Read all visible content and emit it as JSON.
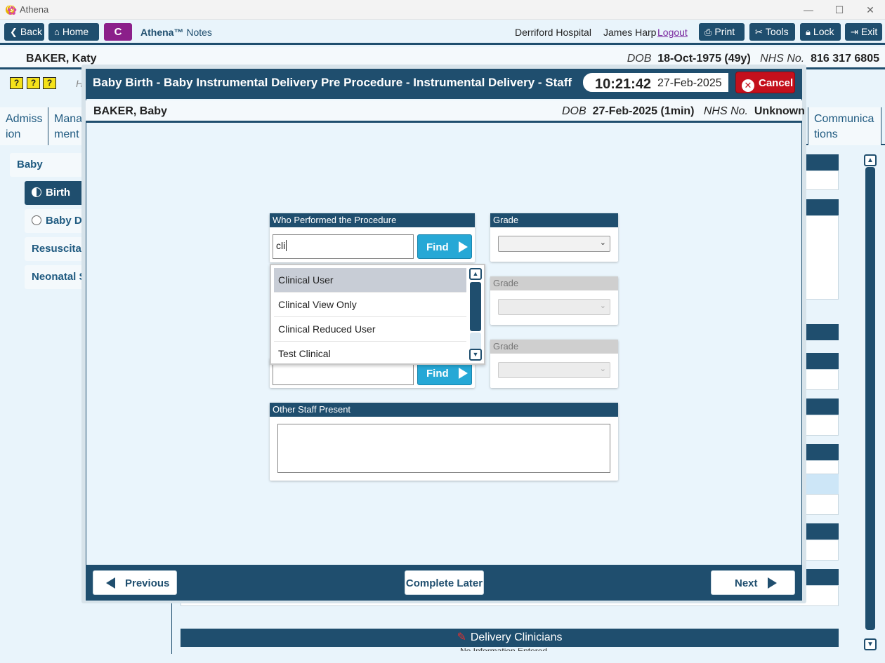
{
  "window": {
    "title": "Athena",
    "logo_glyph": "Ⓐ",
    "minimize": "—",
    "maximize": "☐",
    "close": "✕"
  },
  "toolbar": {
    "back": "Back",
    "home": "Home",
    "badge": "C",
    "brand": "Athena™",
    "brand_suffix": "Notes",
    "hospital": "Derriford Hospital",
    "user": "James Harp",
    "logout": "Logout",
    "print": "Print",
    "tools": "Tools",
    "lock": "Lock",
    "exit": "Exit"
  },
  "patient": {
    "name": "BAKER, Katy",
    "dob_label": "DOB",
    "dob": "18-Oct-1975 (49y)",
    "nhs_label": "NHS No.",
    "nhs": "816 317 6805"
  },
  "background": {
    "help_icons": [
      "?",
      "?",
      "?"
    ],
    "help_text": "H",
    "tabs": [
      "Admiss ion",
      "Mana ment",
      "Communica tions"
    ],
    "nav": [
      "Baby",
      "Birth",
      "Baby Dev",
      "Resuscitati",
      "Neonatal S"
    ],
    "bottom_bar": "Delivery Clinicians",
    "bottom_bar_cut": "No Information Entered"
  },
  "modal": {
    "title": "Baby Birth - Baby Instrumental Delivery Pre Procedure - Instrumental Delivery - Staff",
    "time": "10:21:42",
    "date": "27-Feb-2025",
    "cancel": "Cancel",
    "baby": {
      "name": "BAKER, Baby",
      "dob_label": "DOB",
      "dob": "27-Feb-2025 (1min)",
      "nhs_label": "NHS No.",
      "nhs": "Unknown"
    },
    "who_performed": {
      "label": "Who Performed the Procedure",
      "value": "cli",
      "find": "Find"
    },
    "second_find": {
      "value": "",
      "find": "Find"
    },
    "grade_labels": [
      "Grade",
      "Grade",
      "Grade"
    ],
    "dropdown_items": [
      "Clinical User",
      "Clinical View Only",
      "Clinical Reduced User",
      "Test Clinical"
    ],
    "dropdown_selected_index": 0,
    "other_staff": {
      "label": "Other Staff Present",
      "value": ""
    },
    "footer": {
      "previous": "Previous",
      "complete_later": "Complete Later",
      "next": "Next"
    }
  },
  "colors": {
    "primary": "#1f4e6e",
    "accent": "#26a8d6",
    "danger": "#c4101c",
    "badge": "#8b1f8a"
  }
}
